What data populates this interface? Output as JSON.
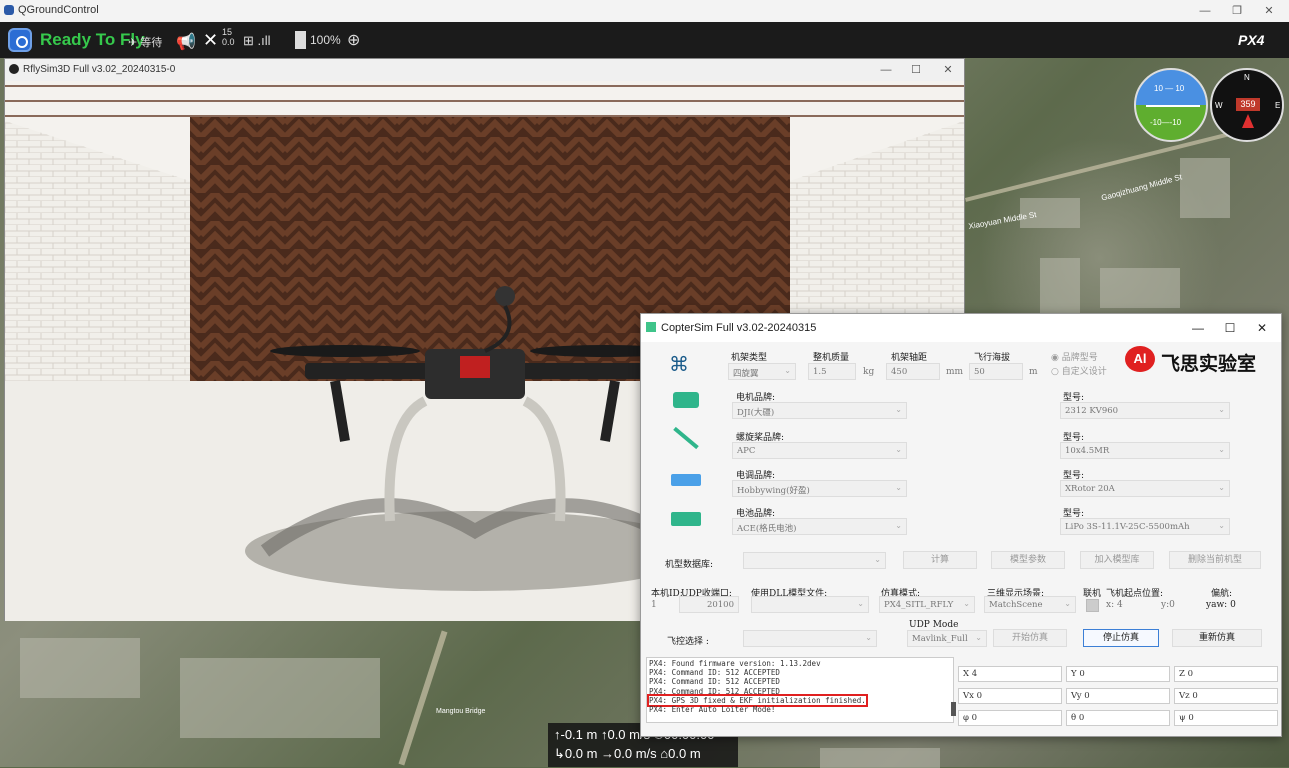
{
  "qgc": {
    "window_title": "QGroundControl",
    "status": "Ready To Fly",
    "mode_text": "等待",
    "sat_count": "15",
    "hdop": "0.0",
    "battery": "100%",
    "brand": "PX4"
  },
  "rflysim": {
    "window_title": "RflySim3D Full v3.02_20240315-0"
  },
  "hud": {
    "pitch_top": "10",
    "pitch_bottom": "-10",
    "heading": "359",
    "compass_n": "N",
    "compass_w": "W",
    "compass_e": "E",
    "alt_rel": "-0.1 m",
    "vspeed": "0.0 m/s",
    "flight_time": "00:00:00",
    "dist": "0.0 m",
    "hspeed": "0.0 m/s",
    "dist_home": "0.0 m"
  },
  "map_labels": {
    "street1": "Gaoqizhuang Middle St",
    "street2": "Xiaoyuan Middle St",
    "bridge": "Mangtou Bridge"
  },
  "coptersim": {
    "window_title": "CopterSim Full v3.02-20240315",
    "frame": {
      "type_label": "机架类型",
      "type_value": "四旋翼",
      "mass_label": "整机质量",
      "mass_value": "1.5",
      "mass_unit": "kg",
      "wheelbase_label": "机架轴距",
      "wheelbase_value": "450",
      "wheelbase_unit": "mm",
      "altitude_label": "飞行海拔",
      "altitude_value": "50",
      "altitude_unit": "m",
      "radio_brand": "品牌型号",
      "radio_custom": "自定义设计"
    },
    "lab_logo_text": "飞思实验室",
    "components": [
      {
        "brand_label": "电机品牌:",
        "brand_value": "DJI(大疆)",
        "model_label": "型号:",
        "model_value": "2312 KV960"
      },
      {
        "brand_label": "螺旋桨品牌:",
        "brand_value": "APC",
        "model_label": "型号:",
        "model_value": "10x4.5MR"
      },
      {
        "brand_label": "电调品牌:",
        "brand_value": "Hobbywing(好盈)",
        "model_label": "型号:",
        "model_value": "XRotor 20A"
      },
      {
        "brand_label": "电池品牌:",
        "brand_value": "ACE(格氏电池)",
        "model_label": "型号:",
        "model_value": "LiPo 3S-11.1V-25C-5500mAh"
      }
    ],
    "db": {
      "label": "机型数据库:",
      "btn_calc": "计算",
      "btn_params": "模型参数",
      "btn_add": "加入模型库",
      "btn_delete": "删除当前机型"
    },
    "sim": {
      "id_label": "本机ID:",
      "id_value": "1",
      "udp_label": "UDP收端口:",
      "udp_value": "20100",
      "dll_label": "使用DLL模型文件:",
      "mode_label": "仿真模式:",
      "mode_value": "PX4_SITL_RFLY",
      "scene_label": "三维显示场景:",
      "scene_value": "MatchScene",
      "link_label": "联机",
      "start_label": "飞机起点位置:",
      "x_label": "x:",
      "x_value": "4",
      "y_label": "y:",
      "y_value": "0",
      "yaw_label": "偏航:",
      "yaw_field": "yaw:",
      "yaw_value": "0",
      "fc_label": "飞控选择 :",
      "udp_mode_label": "UDP Mode",
      "udp_mode_value": "Mavlink_Full",
      "btn_start": "开始仿真",
      "btn_stop": "停止仿真",
      "btn_restart": "重新仿真"
    },
    "log": [
      "PX4: Found firmware version: 1.13.2dev",
      "PX4: Command ID: 512 ACCEPTED",
      "PX4: Command ID: 512 ACCEPTED",
      "PX4: Command ID: 512 ACCEPTED",
      "PX4: GPS 3D fixed & EKF initialization finished.",
      "PX4: Enter Auto Loiter Mode!"
    ],
    "state": {
      "pos": [
        "X 4",
        "Y 0",
        "Z 0"
      ],
      "vel": [
        "Vx 0",
        "Vy 0",
        "Vz 0"
      ],
      "att": [
        "φ 0",
        "θ 0",
        "ψ 0"
      ]
    }
  }
}
